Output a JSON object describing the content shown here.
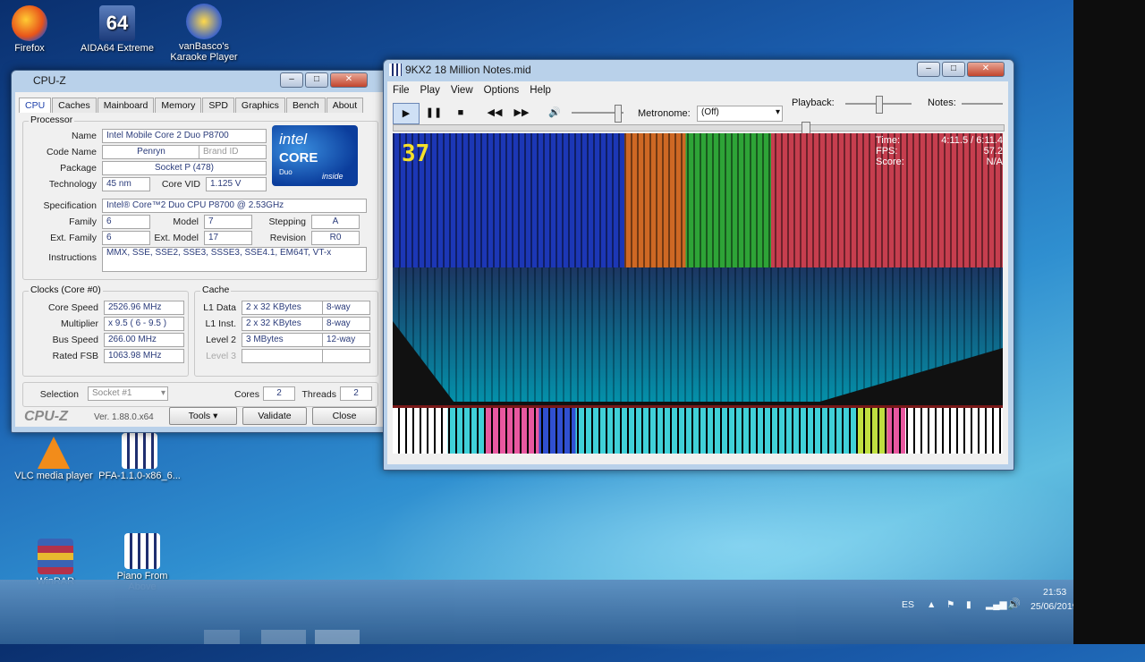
{
  "desktop": {
    "icons": [
      {
        "label": "Firefox"
      },
      {
        "label": "AIDA64 Extreme"
      },
      {
        "label": "vanBasco's Karaoke Player"
      },
      {
        "label": "VLC media player"
      },
      {
        "label": "PFA-1.1.0-x86_6..."
      },
      {
        "label": "WinRAR"
      },
      {
        "label": "Piano From Above"
      }
    ]
  },
  "cpuz": {
    "title": "CPU-Z",
    "tabs": [
      "CPU",
      "Caches",
      "Mainboard",
      "Memory",
      "SPD",
      "Graphics",
      "Bench",
      "About"
    ],
    "processor": {
      "group": "Processor",
      "name_label": "Name",
      "name": "Intel Mobile Core 2 Duo P8700",
      "codename_label": "Code Name",
      "codename": "Penryn",
      "brandid_label": "Brand ID",
      "package_label": "Package",
      "package": "Socket P (478)",
      "tech_label": "Technology",
      "tech": "45 nm",
      "corevid_label": "Core VID",
      "corevid": "1.125 V",
      "spec_label": "Specification",
      "spec": "Intel® Core™2 Duo CPU     P8700  @ 2.53GHz",
      "family_label": "Family",
      "family": "6",
      "model_label": "Model",
      "model": "7",
      "stepping_label": "Stepping",
      "stepping": "A",
      "extfamily_label": "Ext. Family",
      "extfamily": "6",
      "extmodel_label": "Ext. Model",
      "extmodel": "17",
      "revision_label": "Revision",
      "revision": "R0",
      "instr_label": "Instructions",
      "instr": "MMX, SSE, SSE2, SSE3, SSSE3, SSE4.1, EM64T, VT-x"
    },
    "clocks": {
      "group": "Clocks (Core #0)",
      "speed_label": "Core Speed",
      "speed": "2526.96 MHz",
      "mult_label": "Multiplier",
      "mult": "x 9.5 ( 6 - 9.5 )",
      "bus_label": "Bus Speed",
      "bus": "266.00 MHz",
      "fsb_label": "Rated FSB",
      "fsb": "1063.98 MHz"
    },
    "cache": {
      "group": "Cache",
      "l1d_label": "L1 Data",
      "l1d": "2 x 32 KBytes",
      "l1d_way": "8-way",
      "l1i_label": "L1 Inst.",
      "l1i": "2 x 32 KBytes",
      "l1i_way": "8-way",
      "l2_label": "Level 2",
      "l2": "3 MBytes",
      "l2_way": "12-way",
      "l3_label": "Level 3"
    },
    "selection_label": "Selection",
    "selection": "Socket #1",
    "cores_label": "Cores",
    "cores": "2",
    "threads_label": "Threads",
    "threads": "2",
    "brand": "CPU-Z",
    "version": "Ver. 1.88.0.x64",
    "tools": "Tools",
    "validate": "Validate",
    "close": "Close",
    "logo": {
      "brand": "intel",
      "product": "CORE",
      "sub": "Duo",
      "tag": "inside"
    }
  },
  "pfa": {
    "title": "9KX2 18 Million Notes.mid",
    "menu": [
      "File",
      "Play",
      "View",
      "Options",
      "Help"
    ],
    "metronome_label": "Metronome:",
    "metronome": "(Off)",
    "playback_label": "Playback:",
    "notes_label": "Notes:",
    "counter": "37",
    "stats": {
      "time_label": "Time:",
      "time": "4:11.5 / 6:11.4",
      "fps_label": "FPS:",
      "fps": "57.2",
      "score_label": "Score:",
      "score": "N/A"
    }
  },
  "taskbar": {
    "lang": "ES",
    "time": "21:53",
    "date": "25/06/2019"
  }
}
